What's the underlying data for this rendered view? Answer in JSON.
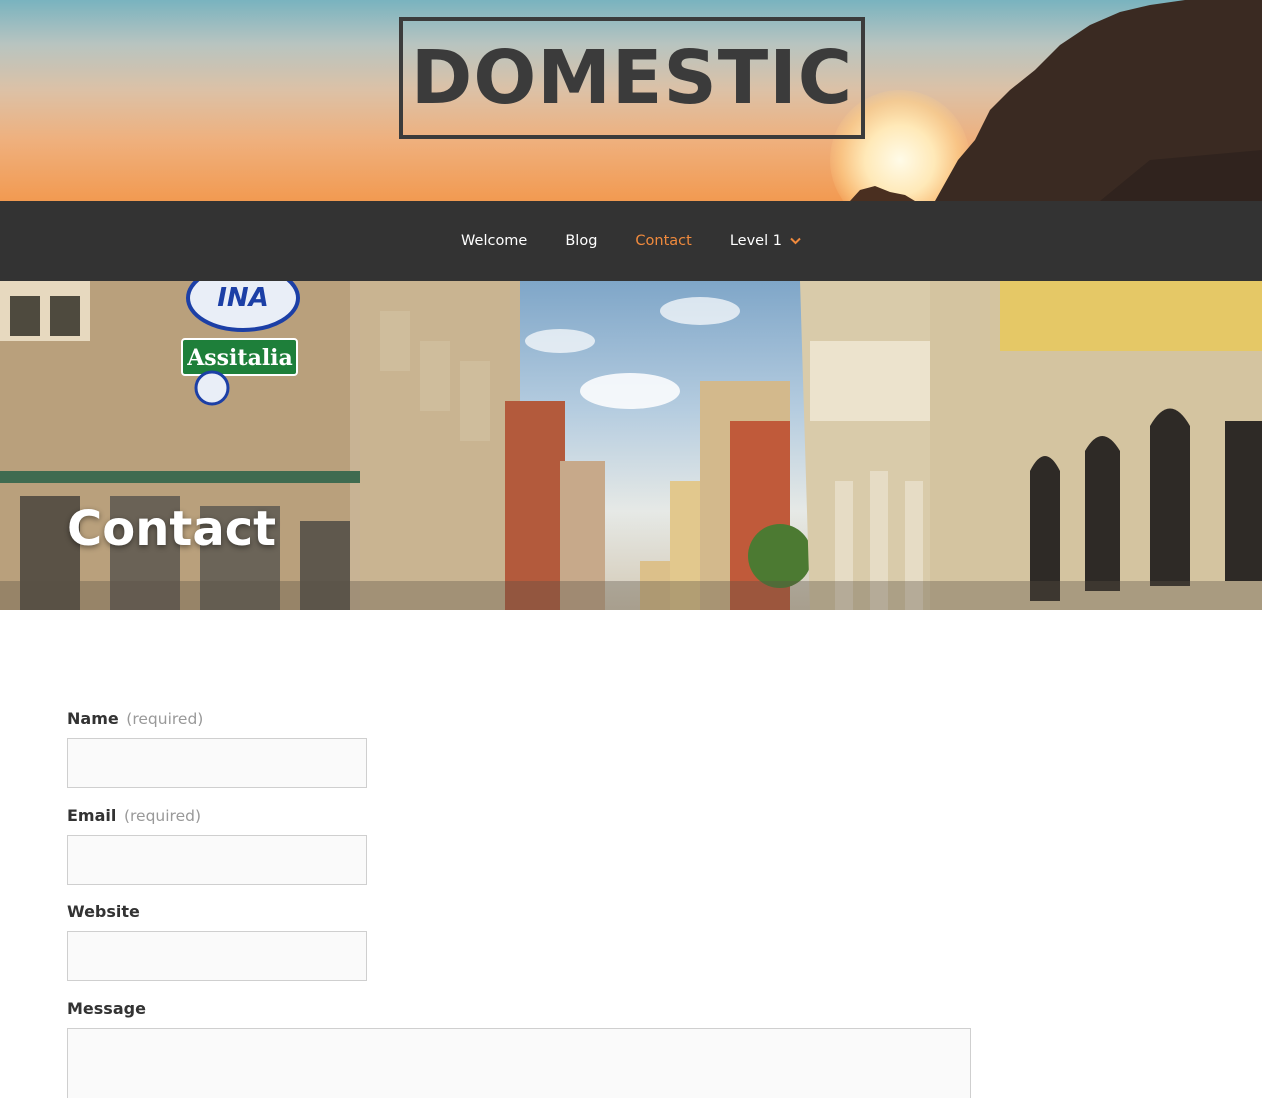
{
  "header": {
    "site_title": "DOMESTIC"
  },
  "nav": {
    "items": [
      {
        "label": "Welcome",
        "active": false
      },
      {
        "label": "Blog",
        "active": false
      },
      {
        "label": "Contact",
        "active": true
      },
      {
        "label": "Level 1",
        "active": false,
        "has_submenu": true
      }
    ],
    "accent_color": "#f08a3d",
    "background_color": "#333333",
    "submenu_icon": "chevron-down-icon"
  },
  "hero": {
    "title": "Contact",
    "signs": {
      "ina": "INA",
      "assitalia": "Assitalia"
    }
  },
  "form": {
    "name": {
      "label": "Name",
      "required_text": "(required)",
      "value": ""
    },
    "email": {
      "label": "Email",
      "required_text": "(required)",
      "value": ""
    },
    "website": {
      "label": "Website",
      "value": ""
    },
    "message": {
      "label": "Message",
      "value": ""
    }
  }
}
